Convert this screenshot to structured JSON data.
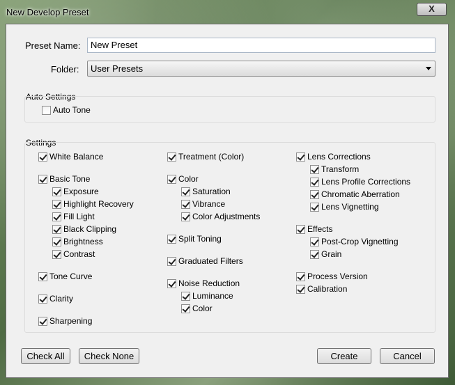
{
  "window": {
    "title": "New Develop Preset",
    "close_glyph": "X"
  },
  "preset_name": {
    "label": "Preset Name:",
    "value": "New Preset"
  },
  "folder": {
    "label": "Folder:",
    "value": "User Presets"
  },
  "auto_settings": {
    "title": "Auto Settings",
    "auto_tone": {
      "label": "Auto Tone",
      "checked": false
    }
  },
  "settings": {
    "title": "Settings",
    "col1": {
      "white_balance": {
        "label": "White Balance",
        "checked": true
      },
      "basic_tone": {
        "label": "Basic Tone",
        "checked": true
      },
      "exposure": {
        "label": "Exposure",
        "checked": true
      },
      "highlight_recovery": {
        "label": "Highlight Recovery",
        "checked": true
      },
      "fill_light": {
        "label": "Fill Light",
        "checked": true
      },
      "black_clipping": {
        "label": "Black Clipping",
        "checked": true
      },
      "brightness": {
        "label": "Brightness",
        "checked": true
      },
      "contrast": {
        "label": "Contrast",
        "checked": true
      },
      "tone_curve": {
        "label": "Tone Curve",
        "checked": true
      },
      "clarity": {
        "label": "Clarity",
        "checked": true
      },
      "sharpening": {
        "label": "Sharpening",
        "checked": true
      }
    },
    "col2": {
      "treatment": {
        "label": "Treatment (Color)",
        "checked": true
      },
      "color": {
        "label": "Color",
        "checked": true
      },
      "saturation": {
        "label": "Saturation",
        "checked": true
      },
      "vibrance": {
        "label": "Vibrance",
        "checked": true
      },
      "color_adjustments": {
        "label": "Color Adjustments",
        "checked": true
      },
      "split_toning": {
        "label": "Split Toning",
        "checked": true
      },
      "graduated_filters": {
        "label": "Graduated Filters",
        "checked": true
      },
      "noise_reduction": {
        "label": "Noise Reduction",
        "checked": true
      },
      "luminance": {
        "label": "Luminance",
        "checked": true
      },
      "nr_color": {
        "label": "Color",
        "checked": true
      }
    },
    "col3": {
      "lens_corrections": {
        "label": "Lens Corrections",
        "checked": true
      },
      "transform": {
        "label": "Transform",
        "checked": true
      },
      "lens_profile": {
        "label": "Lens Profile Corrections",
        "checked": true
      },
      "chromatic_aberration": {
        "label": "Chromatic Aberration",
        "checked": true
      },
      "lens_vignetting": {
        "label": "Lens Vignetting",
        "checked": true
      },
      "effects": {
        "label": "Effects",
        "checked": true
      },
      "post_crop_vignetting": {
        "label": "Post-Crop Vignetting",
        "checked": true
      },
      "grain": {
        "label": "Grain",
        "checked": true
      },
      "process_version": {
        "label": "Process Version",
        "checked": true
      },
      "calibration": {
        "label": "Calibration",
        "checked": true
      }
    }
  },
  "buttons": {
    "check_all": "Check All",
    "check_none": "Check None",
    "create": "Create",
    "cancel": "Cancel"
  }
}
